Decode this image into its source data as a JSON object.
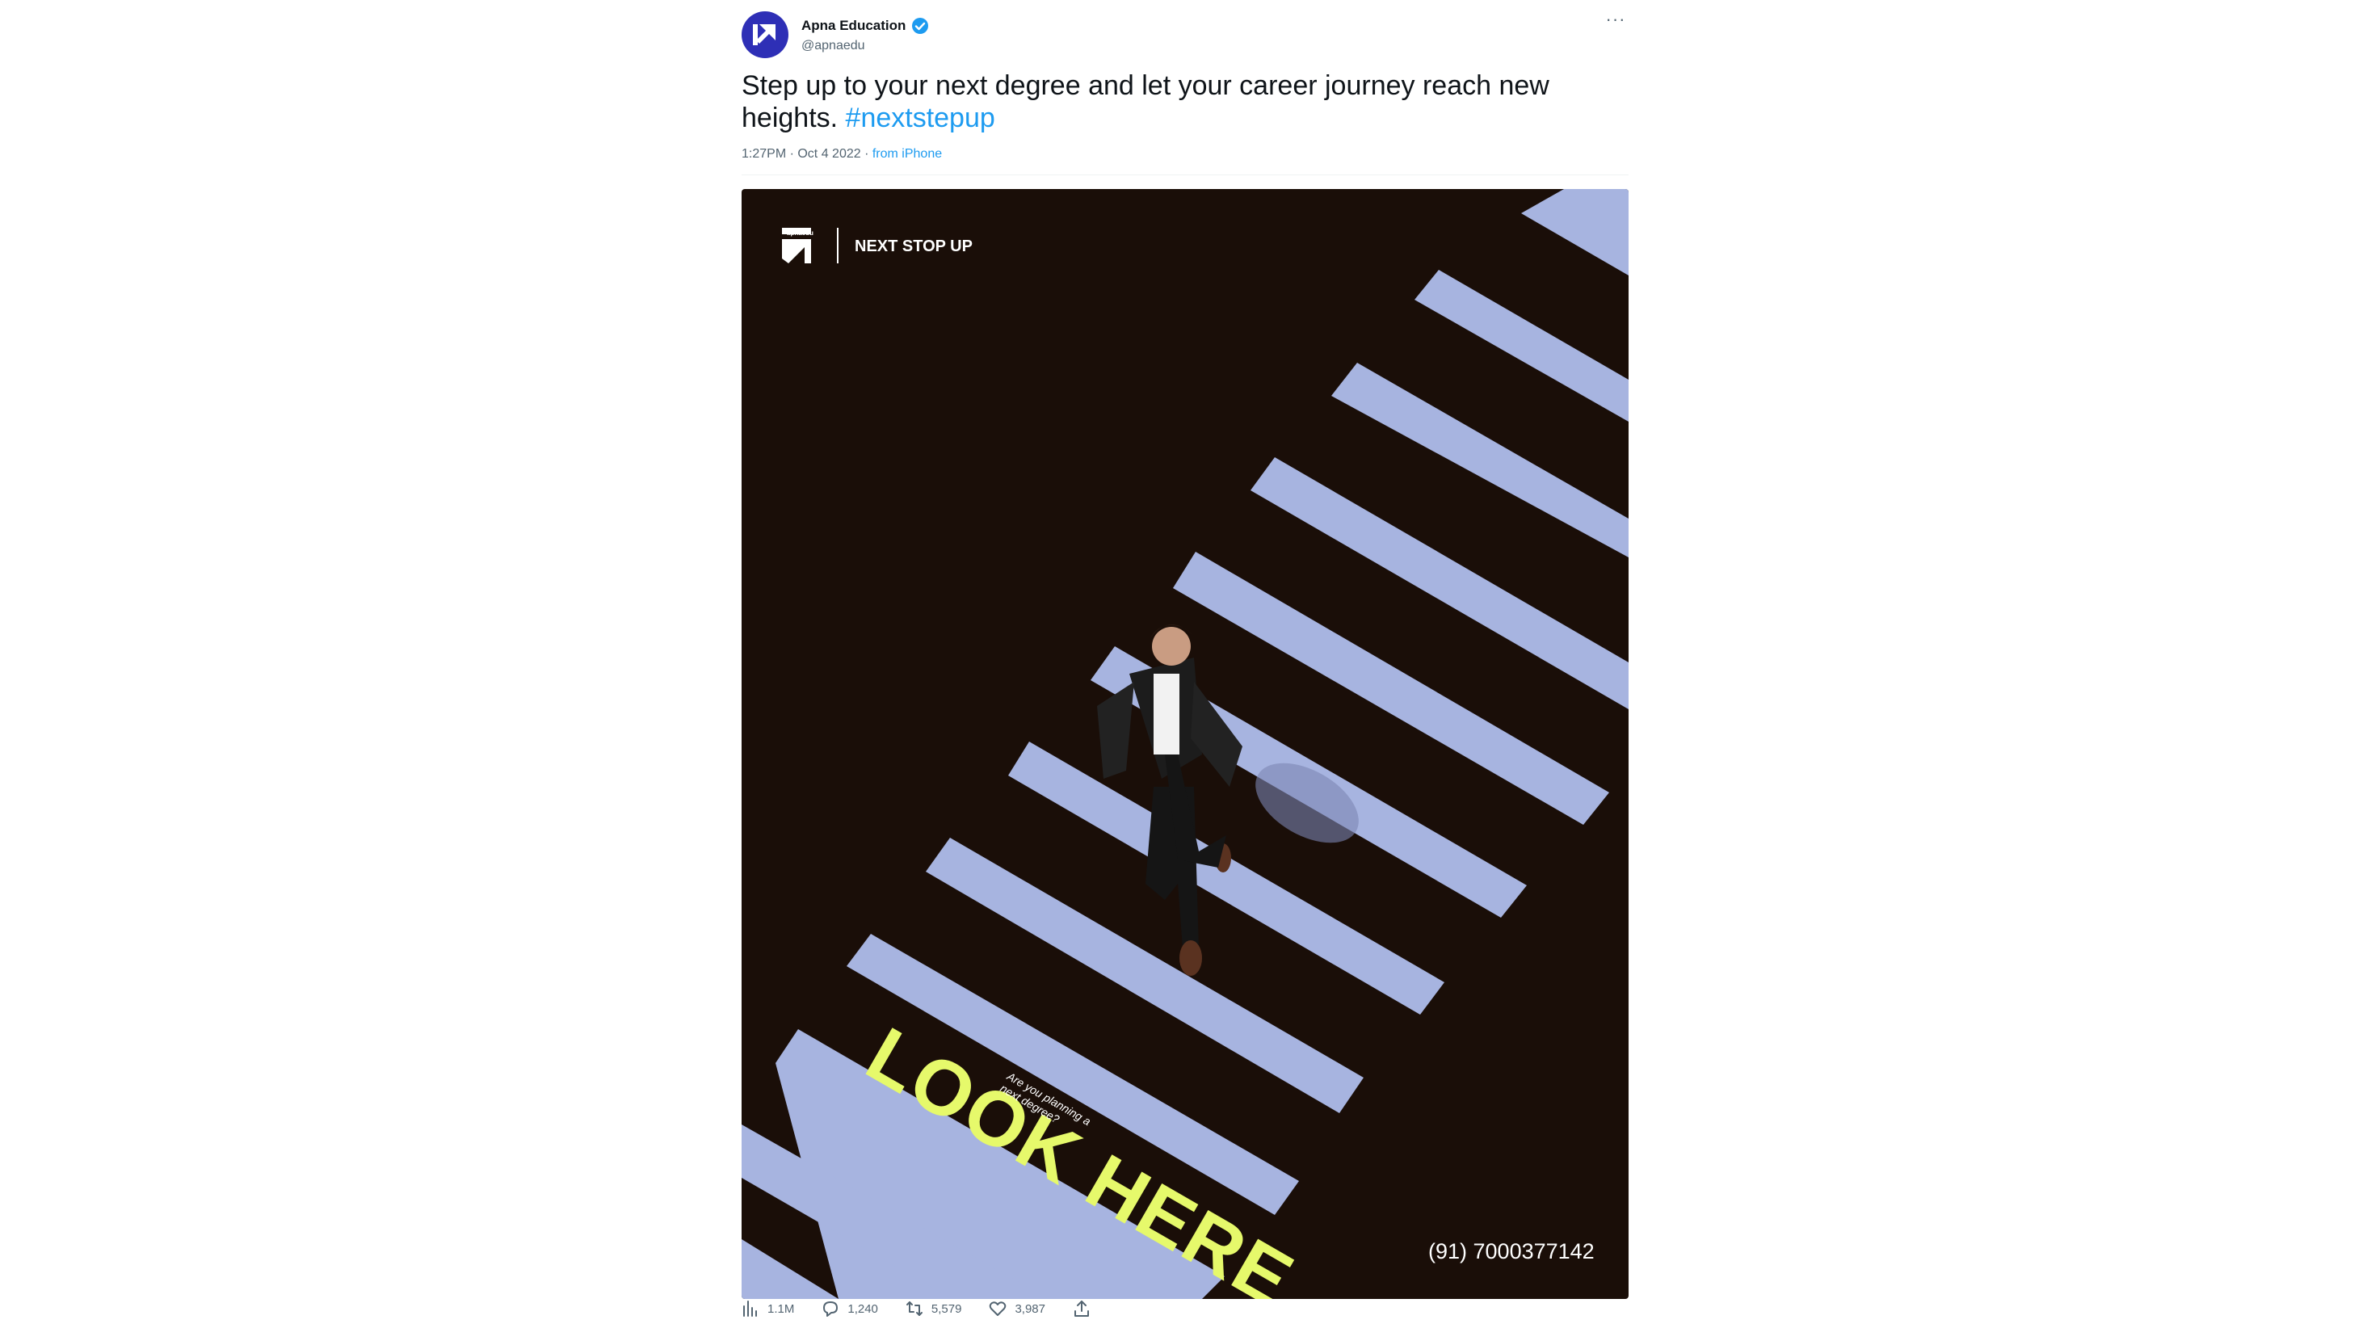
{
  "tweet": {
    "author_name": "Apna Education",
    "author_handle": "@apnaedu",
    "more_label": "···",
    "text": "Step up to your next degree and let your career journey reach new heights. ",
    "hashtag": "#nextstepup",
    "time_date": "1:27PM · Oct 4 2022 · ",
    "source": "from iPhone"
  },
  "poster": {
    "brand_small": "apnaedu",
    "tagline": "NEXT STOP UP",
    "headline": "LOOK HERE",
    "subline_1": "Are you planning a",
    "subline_2": "next degree?",
    "phone": "(91) 7000377142"
  },
  "metrics": {
    "views": "1.1M",
    "replies": "1,240",
    "retweets": "5,579",
    "likes": "3,987"
  },
  "icons": {
    "avatar": "apna-logo-icon",
    "verified": "verified-badge-icon",
    "views": "bar-chart-icon",
    "reply": "comment-bubble-icon",
    "retweet": "retweet-arrows-icon",
    "like": "heart-icon",
    "share": "share-upload-icon"
  },
  "colors": {
    "brand_blue": "#2e2fb6",
    "link_blue": "#1d9bf0",
    "poster_bg": "#1a0e08",
    "stripe": "#a7b4e0",
    "headline_yellow": "#e6f96b"
  }
}
